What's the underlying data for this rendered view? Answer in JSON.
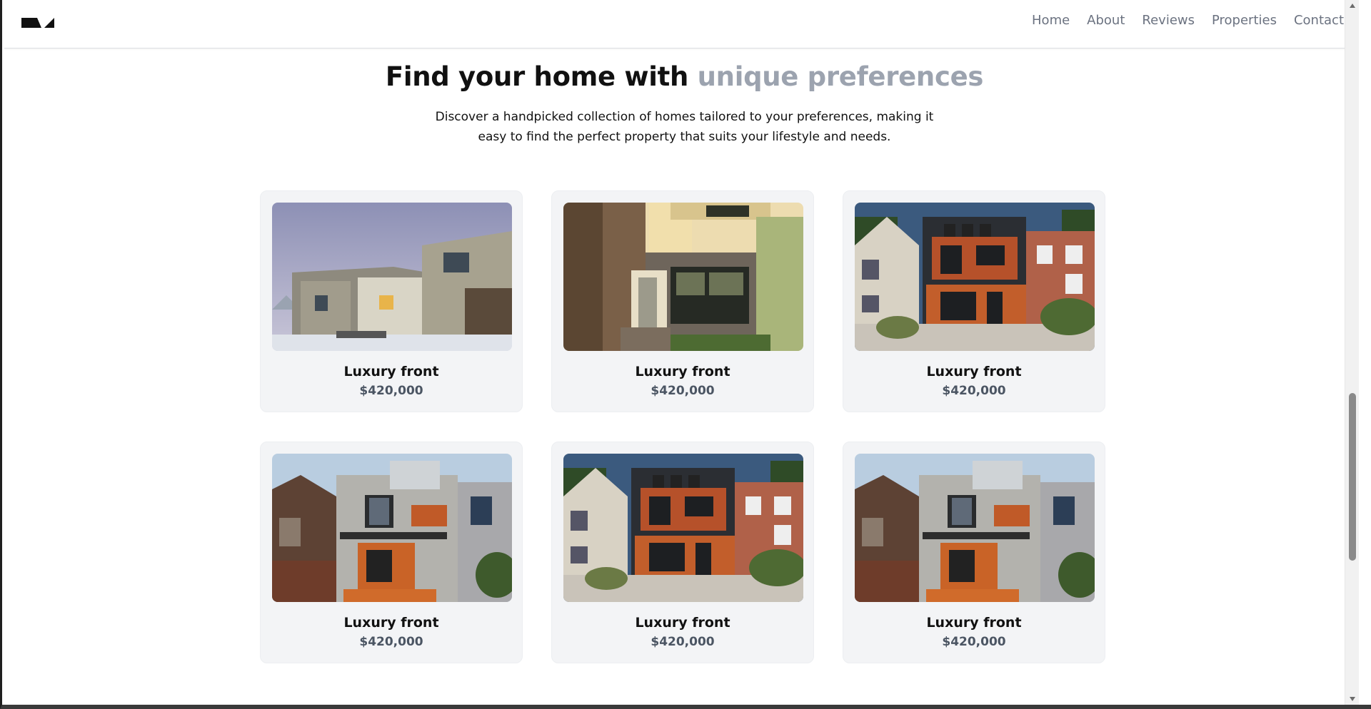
{
  "nav": {
    "logo_icon": "brand-logo-icon",
    "links": [
      "Home",
      "About",
      "Reviews",
      "Properties",
      "Contact"
    ]
  },
  "hero": {
    "title_main": "Find your home with ",
    "title_accent": "unique preferences",
    "subtitle": "Discover a handpicked collection of homes tailored to your preferences, making it easy to find the perfect property that suits your lifestyle and needs."
  },
  "properties": [
    {
      "title": "Luxury front",
      "price": "$420,000",
      "image": "house-photo-snowy-modern"
    },
    {
      "title": "Luxury front",
      "price": "$420,000",
      "image": "house-photo-gray-entrance"
    },
    {
      "title": "Luxury front",
      "price": "$420,000",
      "image": "house-photo-orange-modern"
    },
    {
      "title": "Luxury front",
      "price": "$420,000",
      "image": "house-photo-gray-orange-stairs"
    },
    {
      "title": "Luxury front",
      "price": "$420,000",
      "image": "house-photo-orange-modern"
    },
    {
      "title": "Luxury front",
      "price": "$420,000",
      "image": "house-photo-gray-orange-stairs"
    }
  ],
  "colors": {
    "accent_text": "#9ca3af",
    "card_bg": "#f3f4f6",
    "nav_link": "#6b7280",
    "price": "#4b5563"
  },
  "scrollbar": {
    "icon_up": "arrow-up-icon",
    "icon_down": "arrow-down-icon"
  }
}
